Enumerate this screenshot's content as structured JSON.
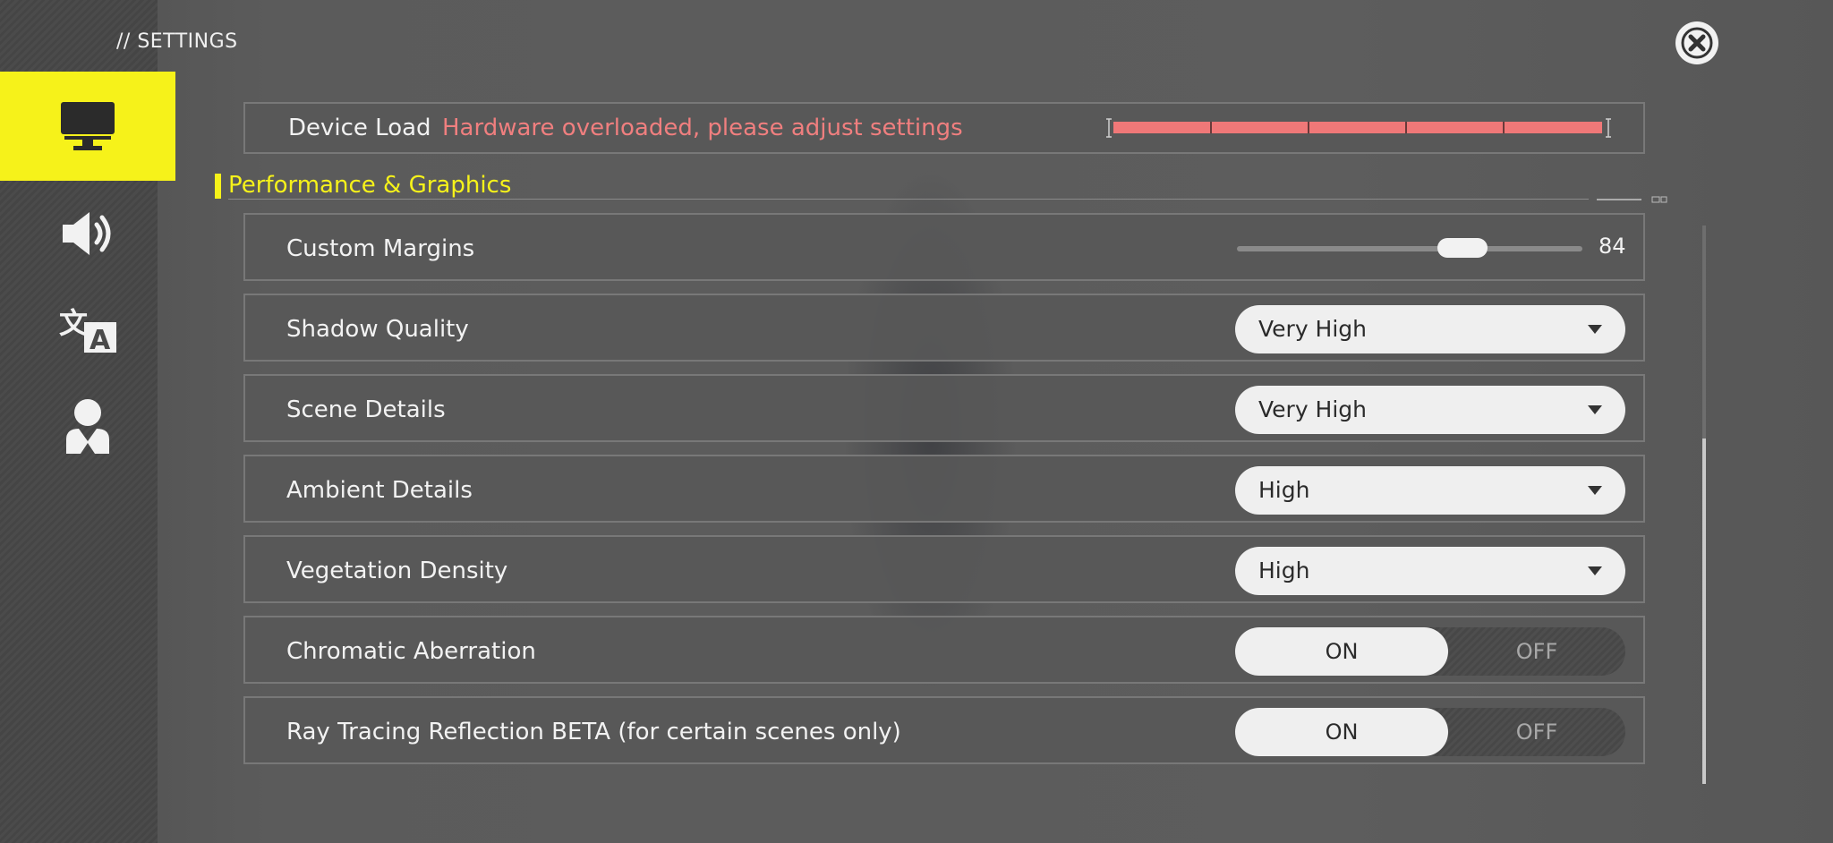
{
  "header": {
    "title": "// SETTINGS"
  },
  "colors": {
    "accent": "#f6f21a",
    "warning": "#f07f7f",
    "load_bar": "#f07878"
  },
  "sidebar": {
    "items": [
      {
        "icon": "monitor-icon",
        "active": true
      },
      {
        "icon": "speaker-icon",
        "active": false
      },
      {
        "icon": "translate-icon",
        "active": false
      },
      {
        "icon": "account-icon",
        "active": false
      }
    ]
  },
  "device_load": {
    "label": "Device Load",
    "warning": "Hardware overloaded, please adjust settings",
    "level": 1.0
  },
  "section": {
    "title": "Performance & Graphics"
  },
  "settings": {
    "custom_margins": {
      "label": "Custom Margins",
      "value": "84",
      "fraction": 0.68
    },
    "shadow_quality": {
      "label": "Shadow Quality",
      "value": "Very High"
    },
    "scene_details": {
      "label": "Scene Details",
      "value": "Very High"
    },
    "ambient_details": {
      "label": "Ambient Details",
      "value": "High"
    },
    "vegetation_density": {
      "label": "Vegetation Density",
      "value": "High"
    },
    "chromatic_aberration": {
      "label": "Chromatic Aberration",
      "on": "ON",
      "off": "OFF",
      "selected": "ON"
    },
    "ray_tracing": {
      "label": "Ray Tracing Reflection BETA (for certain scenes only)",
      "on": "ON",
      "off": "OFF",
      "selected": "ON"
    }
  },
  "scroll": {
    "position": "bottom"
  }
}
